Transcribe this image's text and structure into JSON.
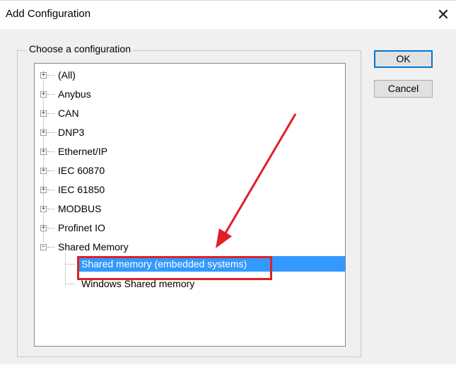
{
  "dialog": {
    "title": "Add Configuration",
    "close_icon": "close-icon",
    "group_label": "Choose a configuration"
  },
  "tree": {
    "items": [
      {
        "label": "(All)",
        "expanded": false
      },
      {
        "label": "Anybus",
        "expanded": false
      },
      {
        "label": "CAN",
        "expanded": false
      },
      {
        "label": "DNP3",
        "expanded": false
      },
      {
        "label": "Ethernet/IP",
        "expanded": false
      },
      {
        "label": "IEC 60870",
        "expanded": false
      },
      {
        "label": "IEC 61850",
        "expanded": false
      },
      {
        "label": "MODBUS",
        "expanded": false
      },
      {
        "label": "Profinet IO",
        "expanded": false
      },
      {
        "label": "Shared Memory",
        "expanded": true,
        "children": [
          {
            "label": "Shared memory (embedded systems)",
            "selected": true
          },
          {
            "label": "Windows Shared memory",
            "selected": false
          }
        ]
      }
    ],
    "expander_collapsed": "+",
    "expander_expanded": "−"
  },
  "buttons": {
    "ok_label": "OK",
    "cancel_label": "Cancel"
  },
  "annotation": {
    "color": "#e01f26",
    "arrow_icon": "red-arrow-icon"
  },
  "colors": {
    "selection": "#3399ff",
    "dialog_bg": "#f0f0f0"
  }
}
